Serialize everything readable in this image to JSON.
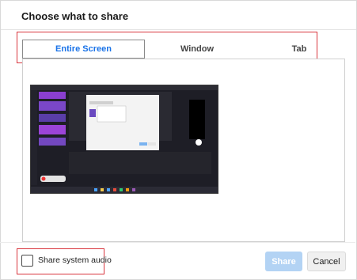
{
  "dialog": {
    "title": "Choose what to share",
    "tabs": [
      {
        "label": "Entire Screen",
        "selected": true
      },
      {
        "label": "Window",
        "selected": false
      },
      {
        "label": "Tab",
        "selected": false
      }
    ],
    "share_system_audio_label": "Share system audio",
    "share_system_audio_checked": false,
    "share_label": "Share",
    "cancel_label": "Cancel"
  },
  "colors": {
    "selected_tab": "#1a73e8",
    "share_disabled": "#b3d3f4",
    "highlight_outline": "#d9363e"
  },
  "preview": {
    "icon": "screen-preview-thumbnail"
  }
}
